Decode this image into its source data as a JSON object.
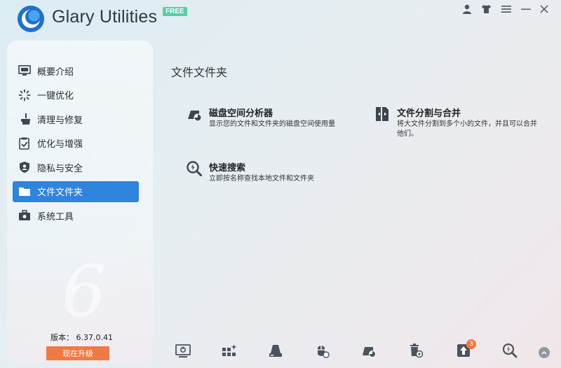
{
  "app": {
    "title": "Glary Utilities",
    "badge": "FREE"
  },
  "sidebar": {
    "items": [
      {
        "label": "概要介绍",
        "icon": "monitor-icon",
        "active": false
      },
      {
        "label": "一键优化",
        "icon": "sparkle-icon",
        "active": false
      },
      {
        "label": "清理与修复",
        "icon": "broom-icon",
        "active": false
      },
      {
        "label": "优化与增强",
        "icon": "checklist-icon",
        "active": false
      },
      {
        "label": "隐私与安全",
        "icon": "shield-icon",
        "active": false
      },
      {
        "label": "文件文件夹",
        "icon": "folder-icon",
        "active": true
      },
      {
        "label": "系统工具",
        "icon": "toolbox-icon",
        "active": false
      }
    ],
    "version": "版本： 6.37.0.41",
    "upgrade_label": "现在升级"
  },
  "main": {
    "title": "文件文件夹",
    "tools": [
      {
        "name": "磁盘空间分析器",
        "desc": "显示您的文件和文件夹的磁盘空间使用量",
        "icon": "disk-analyzer-icon"
      },
      {
        "name": "文件分割与合并",
        "desc": "将大文件分割到多个小的文件，并且可以合并他们。",
        "icon": "file-split-icon"
      },
      {
        "name": "快速搜索",
        "desc": "立即按名称查找本地文件和文件夹",
        "icon": "quick-search-icon"
      }
    ]
  },
  "bottom_bar": {
    "upgrade_badge_count": "3"
  },
  "colors": {
    "accent": "#2f84de",
    "upgrade": "#f07a44",
    "free_badge": "#56cfa6",
    "icon_dark": "#4a5460"
  }
}
